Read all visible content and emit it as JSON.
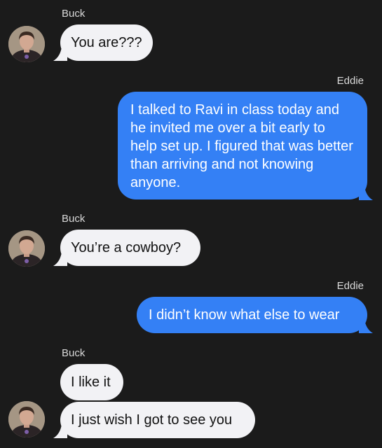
{
  "colors": {
    "background": "#1b1b1b",
    "incoming_bubble": "#f2f2f5",
    "outgoing_bubble": "#3480f5"
  },
  "messages": [
    {
      "sender": "Buck",
      "direction": "incoming",
      "text": "You are???"
    },
    {
      "sender": "Eddie",
      "direction": "outgoing",
      "text": "I talked to Ravi in class today and he invited me over a bit early to help set up. I figured that was better than arriving and not knowing anyone."
    },
    {
      "sender": "Buck",
      "direction": "incoming",
      "text": "You’re a cowboy?"
    },
    {
      "sender": "Eddie",
      "direction": "outgoing",
      "text": "I didn’t know what else to wear"
    },
    {
      "sender": "Buck",
      "direction": "incoming",
      "text": "I like it"
    },
    {
      "sender": "Buck",
      "direction": "incoming",
      "text": "I just wish I got to see you"
    }
  ],
  "avatar_icon": "contact-photo-icon"
}
